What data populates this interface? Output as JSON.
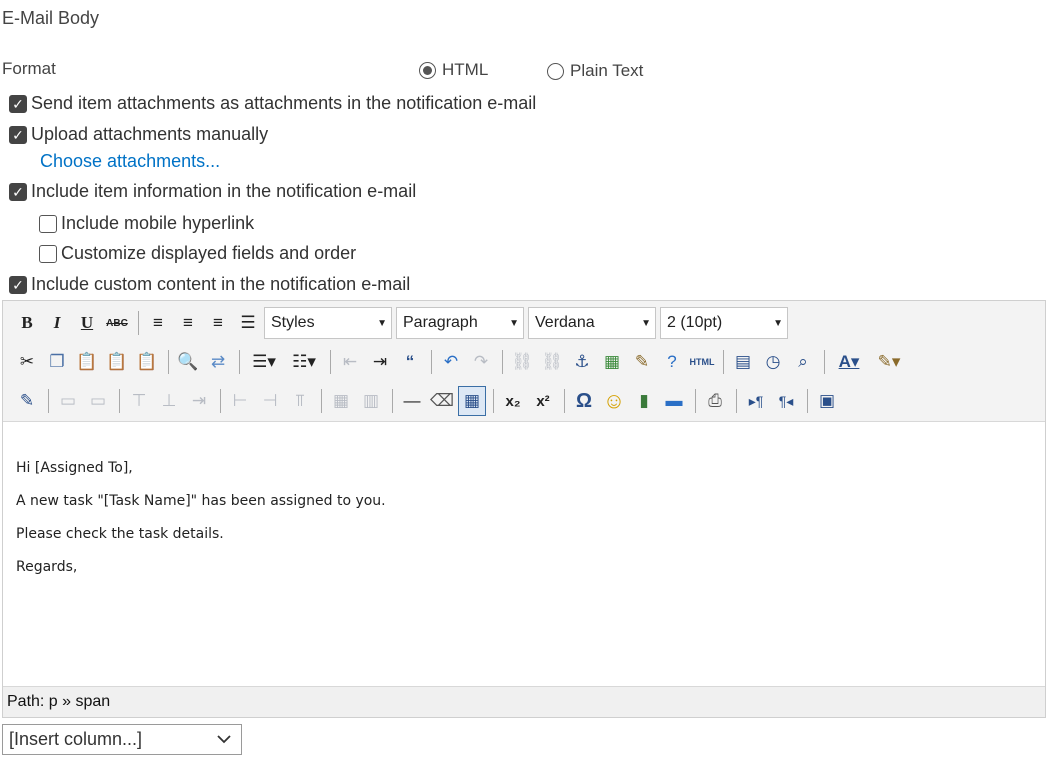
{
  "section_title": "E-Mail Body",
  "format": {
    "label": "Format",
    "options": [
      {
        "label": "HTML",
        "selected": true
      },
      {
        "label": "Plain Text",
        "selected": false
      }
    ]
  },
  "options": {
    "send_attachments": {
      "label": "Send item attachments as attachments in the notification e-mail",
      "checked": true
    },
    "upload_manually": {
      "label": "Upload attachments manually",
      "checked": true
    },
    "choose_attachments_link": "Choose attachments...",
    "include_item_info": {
      "label": "Include item information in the notification e-mail",
      "checked": true
    },
    "mobile_hyperlink": {
      "label": "Include mobile hyperlink",
      "checked": false
    },
    "customize_fields": {
      "label": "Customize displayed fields and order",
      "checked": false
    },
    "custom_content": {
      "label": "Include custom content in the notification e-mail",
      "checked": true
    }
  },
  "editor": {
    "dropdowns": {
      "styles": "Styles",
      "paragraph": "Paragraph",
      "font": "Verdana",
      "size": "2 (10pt)"
    },
    "toolbar_glyphs": {
      "bold": "B",
      "italic": "I",
      "underline": "U",
      "strikethrough": "ABC",
      "html_source": "HTML",
      "subscript": "x₂",
      "superscript": "x²",
      "omega": "Ω"
    },
    "content_lines": [
      "Hi [Assigned To],",
      "A new task \"[Task Name]\" has been assigned to you.",
      "Please check the task details.",
      "Regards,"
    ],
    "path": "Path: p » span"
  },
  "insert_column": {
    "placeholder": "[Insert column...]"
  }
}
